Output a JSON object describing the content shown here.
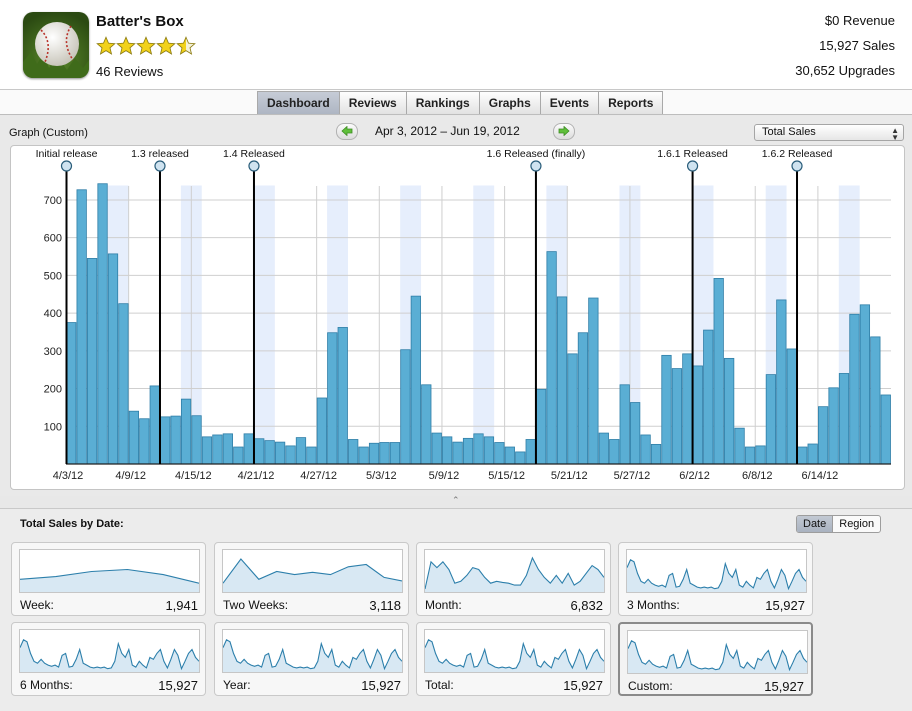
{
  "app": {
    "name": "Batter's Box",
    "rating": 4.5,
    "reviews": "46 Reviews",
    "icon": "baseball-icon"
  },
  "stats": {
    "revenue": "$0 Revenue",
    "sales": "15,927 Sales",
    "upgrades": "30,652 Upgrades"
  },
  "tabs": [
    {
      "label": "Dashboard",
      "active": true
    },
    {
      "label": "Reviews",
      "active": false
    },
    {
      "label": "Rankings",
      "active": false
    },
    {
      "label": "Graphs",
      "active": false
    },
    {
      "label": "Events",
      "active": false
    },
    {
      "label": "Reports",
      "active": false
    }
  ],
  "graph": {
    "label": "Graph (Custom)",
    "date_range": "Apr 3, 2012 – Jun 19, 2012",
    "metric": "Total Sales",
    "prev_icon": "left-arrow-icon",
    "next_icon": "right-arrow-icon"
  },
  "colors": {
    "bar": "#5aaed4",
    "bar_stroke": "#2f7ea7",
    "weekend_band": "#e6eefc",
    "grid": "#cfcfcf",
    "spark_fill": "#d8e8f3",
    "spark_line": "#2c7fab",
    "arrow_green": "#5fbf3a"
  },
  "chart_data": {
    "type": "bar",
    "x_ticks": [
      "4/3/12",
      "4/9/12",
      "4/15/12",
      "4/21/12",
      "4/27/12",
      "5/3/12",
      "5/9/12",
      "5/15/12",
      "5/21/12",
      "5/27/12",
      "6/2/12",
      "6/8/12",
      "6/14/12"
    ],
    "y_ticks": [
      100,
      200,
      300,
      400,
      500,
      600,
      700
    ],
    "ylim": [
      0,
      790
    ],
    "values": [
      375,
      727,
      545,
      743,
      557,
      425,
      140,
      120,
      207,
      125,
      127,
      172,
      128,
      72,
      77,
      80,
      45,
      80,
      67,
      62,
      58,
      48,
      70,
      45,
      175,
      348,
      362,
      65,
      45,
      55,
      57,
      57,
      303,
      445,
      210,
      82,
      72,
      58,
      68,
      80,
      72,
      57,
      45,
      32,
      65,
      198,
      563,
      443,
      292,
      348,
      440,
      82,
      65,
      210,
      163,
      77,
      52,
      288,
      253,
      292,
      260,
      355,
      492,
      280,
      95,
      45,
      48,
      237,
      435,
      305,
      45,
      53,
      152,
      202,
      240,
      397,
      422,
      337,
      183
    ],
    "weekend_bands": [
      [
        4,
        5
      ],
      [
        11,
        12
      ],
      [
        18,
        19
      ],
      [
        25,
        26
      ],
      [
        32,
        33
      ],
      [
        39,
        40
      ],
      [
        46,
        47
      ],
      [
        53,
        54
      ],
      [
        60,
        61
      ],
      [
        67,
        68
      ],
      [
        74,
        75
      ]
    ],
    "events": [
      {
        "label": "Initial release",
        "index": 0
      },
      {
        "label": "1.3 released",
        "index": 9
      },
      {
        "label": "1.4 Released",
        "index": 18
      },
      {
        "label": "1.6 Released (finally)",
        "index": 45
      },
      {
        "label": "1.6.1 Released",
        "index": 60
      },
      {
        "label": "1.6.2 Released",
        "index": 70
      }
    ],
    "grid": true
  },
  "lower": {
    "title": "Total Sales by Date:",
    "segments": [
      {
        "label": "Date",
        "active": true
      },
      {
        "label": "Region",
        "active": false
      }
    ],
    "cards": [
      {
        "label": "Week:",
        "value": "1,941",
        "selected": false,
        "points": [
          30,
          37,
          50,
          55,
          42,
          20
        ]
      },
      {
        "label": "Two Weeks:",
        "value": "3,118",
        "selected": false,
        "points": [
          20,
          82,
          30,
          50,
          42,
          48,
          42,
          62,
          68,
          35,
          26
        ]
      },
      {
        "label": "Month:",
        "value": "6,832",
        "selected": false,
        "points": [
          5,
          75,
          60,
          75,
          55,
          20,
          25,
          40,
          60,
          55,
          35,
          20,
          25,
          22,
          20,
          15,
          15,
          40,
          85,
          55,
          35,
          20,
          40,
          20,
          45,
          15,
          25,
          45,
          65,
          55,
          35
        ]
      },
      {
        "label": "3 Months:",
        "value": "15,927",
        "selected": false,
        "points": [
          60,
          80,
          75,
          45,
          25,
          20,
          30,
          20,
          15,
          12,
          15,
          10,
          40,
          45,
          10,
          12,
          30,
          55,
          20,
          15,
          10,
          8,
          10,
          8,
          10,
          6,
          8,
          25,
          70,
          45,
          35,
          55,
          15,
          10,
          25,
          15,
          8,
          35,
          30,
          45,
          55,
          25,
          8,
          30,
          55,
          40,
          6,
          25,
          45,
          55,
          35,
          25
        ]
      },
      {
        "label": "6 Months:",
        "value": "15,927",
        "selected": false,
        "points": [
          60,
          80,
          75,
          45,
          25,
          20,
          30,
          20,
          15,
          12,
          15,
          10,
          40,
          45,
          10,
          12,
          30,
          55,
          20,
          15,
          10,
          8,
          10,
          8,
          10,
          6,
          8,
          25,
          70,
          45,
          35,
          55,
          15,
          10,
          25,
          15,
          8,
          35,
          30,
          45,
          55,
          25,
          8,
          30,
          55,
          40,
          6,
          25,
          45,
          55,
          35,
          25
        ]
      },
      {
        "label": "Year:",
        "value": "15,927",
        "selected": false,
        "points": [
          60,
          80,
          75,
          45,
          25,
          20,
          30,
          20,
          15,
          12,
          15,
          10,
          40,
          45,
          10,
          12,
          30,
          55,
          20,
          15,
          10,
          8,
          10,
          8,
          10,
          6,
          8,
          25,
          70,
          45,
          35,
          55,
          15,
          10,
          25,
          15,
          8,
          35,
          30,
          45,
          55,
          25,
          8,
          30,
          55,
          40,
          6,
          25,
          45,
          55,
          35,
          25
        ]
      },
      {
        "label": "Total:",
        "value": "15,927",
        "selected": false,
        "points": [
          60,
          80,
          75,
          45,
          25,
          20,
          30,
          20,
          15,
          12,
          15,
          10,
          40,
          45,
          10,
          12,
          30,
          55,
          20,
          15,
          10,
          8,
          10,
          8,
          10,
          6,
          8,
          25,
          70,
          45,
          35,
          55,
          15,
          10,
          25,
          15,
          8,
          35,
          30,
          45,
          55,
          25,
          8,
          30,
          55,
          40,
          6,
          25,
          45,
          55,
          35,
          25
        ]
      },
      {
        "label": "Custom:",
        "value": "15,927",
        "selected": true,
        "points": [
          60,
          80,
          75,
          45,
          25,
          20,
          30,
          20,
          15,
          12,
          15,
          10,
          40,
          45,
          10,
          12,
          30,
          55,
          20,
          15,
          10,
          8,
          10,
          8,
          10,
          6,
          8,
          25,
          70,
          45,
          35,
          55,
          15,
          10,
          25,
          15,
          8,
          35,
          30,
          45,
          55,
          25,
          8,
          30,
          55,
          40,
          6,
          25,
          45,
          55,
          35,
          25
        ]
      }
    ]
  }
}
